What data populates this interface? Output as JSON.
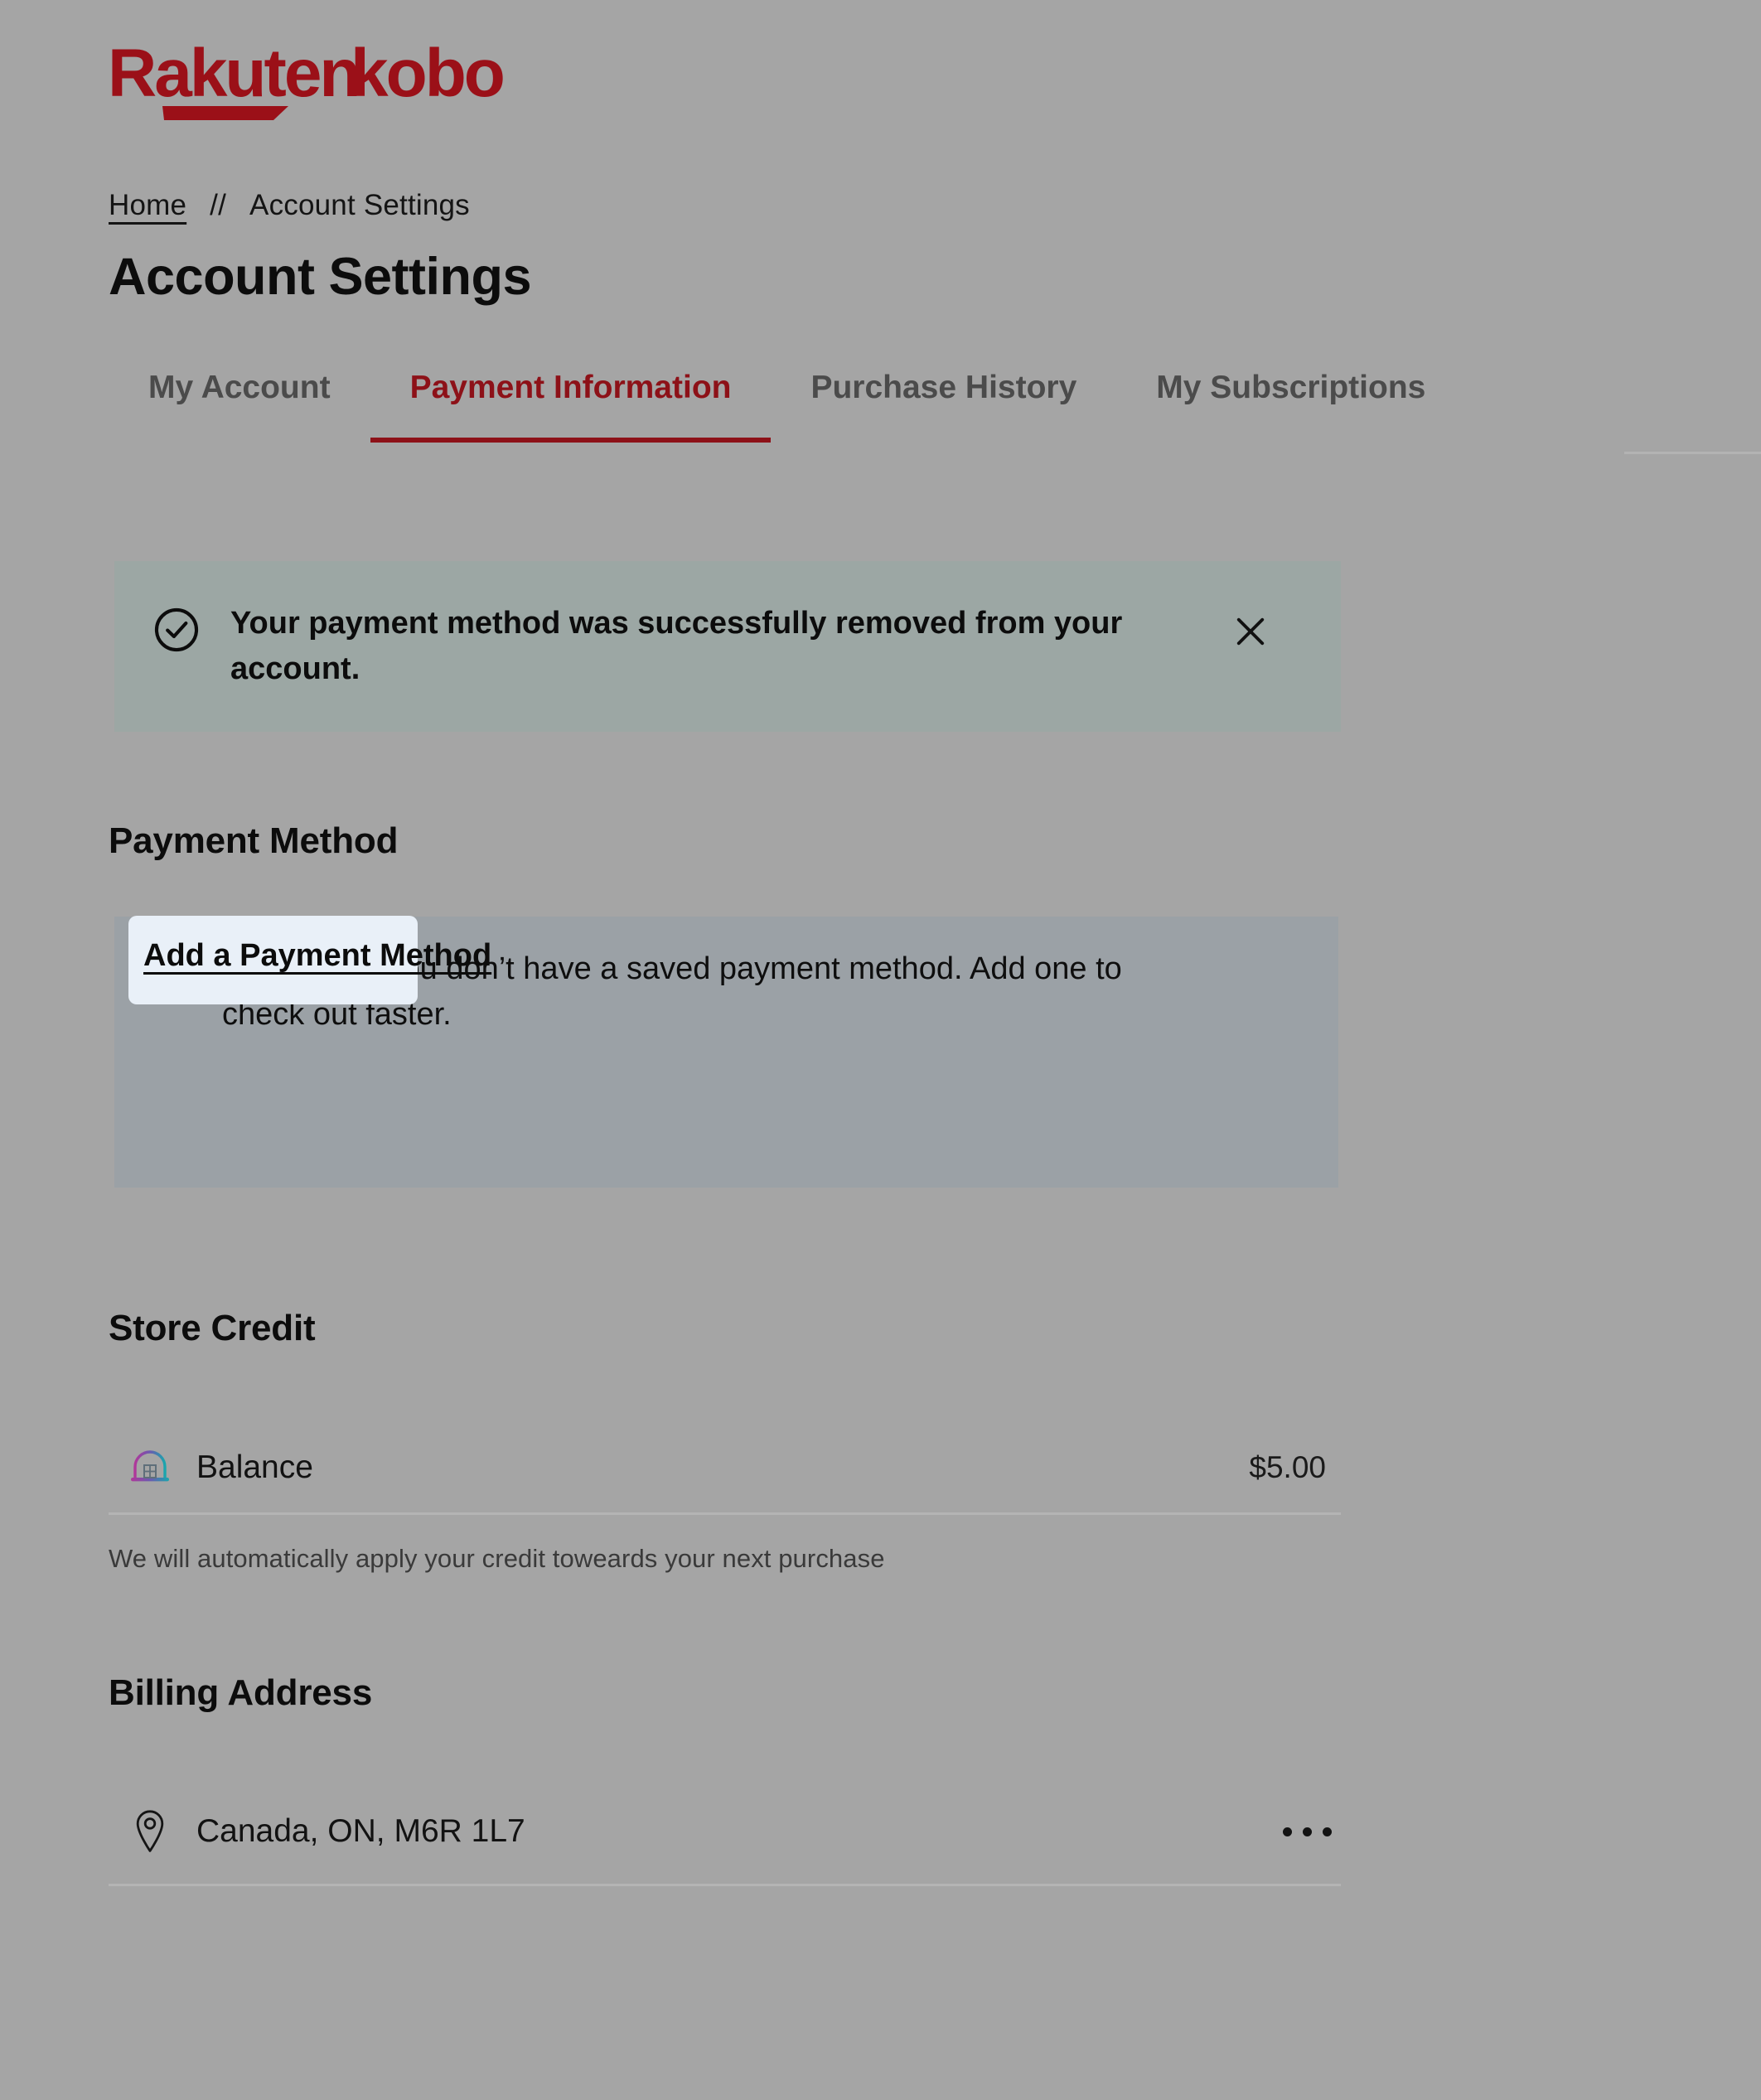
{
  "brand": {
    "logo_text_primary": "Rakuten",
    "logo_text_secondary": "kobo",
    "logo_color": "#9b1018",
    "accent_color": "#8d1118"
  },
  "breadcrumb": {
    "home_label": "Home",
    "separator": "//",
    "current_label": "Account Settings"
  },
  "page": {
    "title": "Account Settings",
    "background_color": "#a5a5a5"
  },
  "tabs": [
    {
      "label": "My Account",
      "active": false
    },
    {
      "label": "Payment Information",
      "active": true
    },
    {
      "label": "Purchase History",
      "active": false
    },
    {
      "label": "My Subscriptions",
      "active": false
    }
  ],
  "banner": {
    "icon": "check-circle-icon",
    "message": "Your payment method was successfully removed from your account.",
    "close_icon": "close-icon",
    "background_color": "#9ca7a4"
  },
  "payment_method": {
    "heading": "Payment Method",
    "empty_state": {
      "icon": "lightbulb-icon",
      "message": "It looks like you don’t have a saved payment method. Add one to check out faster.",
      "cta_label": "Add a Payment Method",
      "cta_focus_color": "#e9f0f8",
      "background_color": "#9ba1a6"
    }
  },
  "store_credit": {
    "heading": "Store Credit",
    "row": {
      "icon": "store-credit-arch-icon",
      "label": "Balance",
      "value": "$5.00"
    },
    "helper_text": "We will automatically apply your credit toweards your next purchase"
  },
  "billing_address": {
    "heading": "Billing Address",
    "row": {
      "icon": "map-pin-icon",
      "label": "Canada, ON, M6R 1L7",
      "menu_icon": "ellipsis-icon"
    }
  }
}
